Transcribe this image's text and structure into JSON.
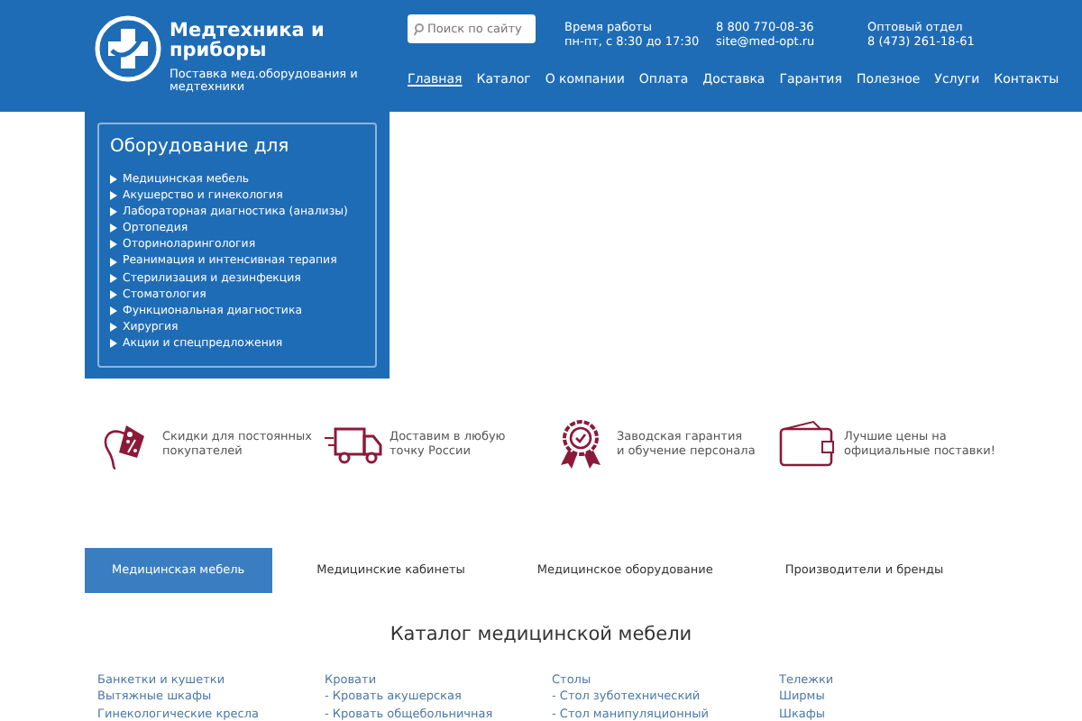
{
  "header": {
    "logo_title": "Медтехника и приборы",
    "logo_subtitle": "Поставка мед.оборудования и медтехники",
    "search": {
      "placeholder": "Поиск по сайту"
    },
    "info": [
      {
        "label": "Время работы",
        "value": "пн-пт, с 8:30 до 17:30"
      },
      {
        "label": "8 800 770-08-36",
        "value": "site@med-opt.ru"
      },
      {
        "label": "Оптовый отдел",
        "value": "8 (473) 261-18-61"
      }
    ],
    "nav": [
      {
        "label": "Главная",
        "selected": true
      },
      {
        "label": "Каталог",
        "selected": false
      },
      {
        "label": "О компании",
        "selected": false
      },
      {
        "label": "Оплата",
        "selected": false
      },
      {
        "label": "Доставка",
        "selected": false
      },
      {
        "label": "Гарантия",
        "selected": false
      },
      {
        "label": "Полезное",
        "selected": false
      },
      {
        "label": "Услуги",
        "selected": false
      },
      {
        "label": "Контакты",
        "selected": false
      }
    ]
  },
  "sidebar": {
    "title": "Оборудование для",
    "items": [
      "Медицинская мебель",
      "Акушерство и гинекология",
      "Лабораторная диагностика (анализы)",
      "Ортопедия",
      "Оториноларингология",
      "Реанимация и интенсивная терапия",
      "Стерилизация и дезинфекция",
      "Стоматология",
      "Функциональная диагностика",
      "Хирургия",
      "Акции и спецпредложения"
    ]
  },
  "features": [
    {
      "kind": "tag",
      "lines": [
        "Скидки для постоянных",
        "покупателей"
      ]
    },
    {
      "kind": "truck",
      "lines": [
        "Доставим в любую",
        "точку России"
      ]
    },
    {
      "kind": "badge",
      "lines": [
        "Заводская гарантия",
        "и обучение персонала"
      ]
    },
    {
      "kind": "wallet",
      "lines": [
        "Лучшие цены на",
        "официальные поставки!"
      ]
    }
  ],
  "tabs": [
    {
      "label": "Медицинская мебель",
      "selected": true
    },
    {
      "label": "Медицинские кабинеты",
      "selected": false
    },
    {
      "label": "Медицинское оборудование",
      "selected": false
    },
    {
      "label": "Производители и бренды",
      "selected": false
    }
  ],
  "catalog": {
    "title": "Каталог медицинской мебели",
    "columns": [
      [
        "Банкетки и кушетки",
        "Вытяжные шкафы",
        "Гинекологические кресла"
      ],
      [
        "Кровати",
        "- Кровать акушерская",
        "- Кровать общебольничная"
      ],
      [
        "Столы",
        "- Стол зуботехнический",
        "- Стол манипуляционный"
      ],
      [
        "Тележки",
        "Ширмы",
        "Шкафы"
      ]
    ]
  }
}
